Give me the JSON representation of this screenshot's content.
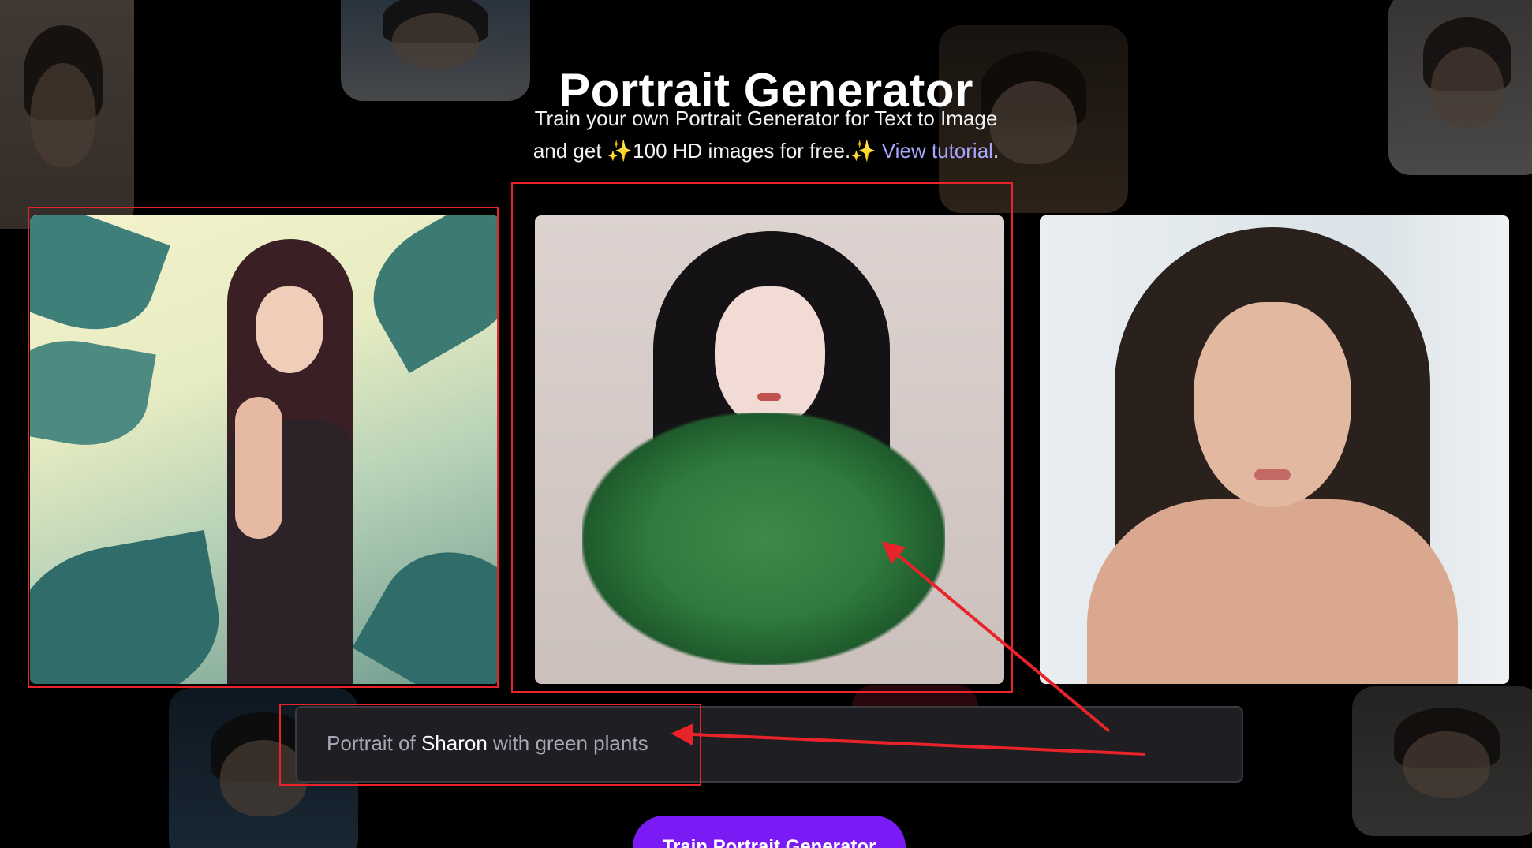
{
  "hero": {
    "title": "Portrait Generator",
    "subtitle_line1": "Train your own Portrait Generator for Text to Image",
    "subtitle_line2_pre": "and get ",
    "sparkle": "✨",
    "subtitle_line2_mid": "100 HD images for free.",
    "tutorial_link": "View tutorial",
    "period": "."
  },
  "gallery": {
    "images": [
      {
        "alt": "illustrated portrait with palm trees",
        "icon": "portrait-image"
      },
      {
        "alt": "illustrated portrait with green plants",
        "icon": "portrait-image"
      },
      {
        "alt": "reference selfie photo",
        "icon": "photo-image"
      }
    ]
  },
  "prompt": {
    "prefix": "Portrait of ",
    "name": "Sharon",
    "suffix": " with green plants"
  },
  "cta": {
    "label": "Train Portrait Generator"
  },
  "colors": {
    "background": "#000000",
    "accent": "#7a1bf5",
    "link": "#a9a6ff",
    "highlight": "#e8232a",
    "input_bg": "#1f1e22"
  }
}
